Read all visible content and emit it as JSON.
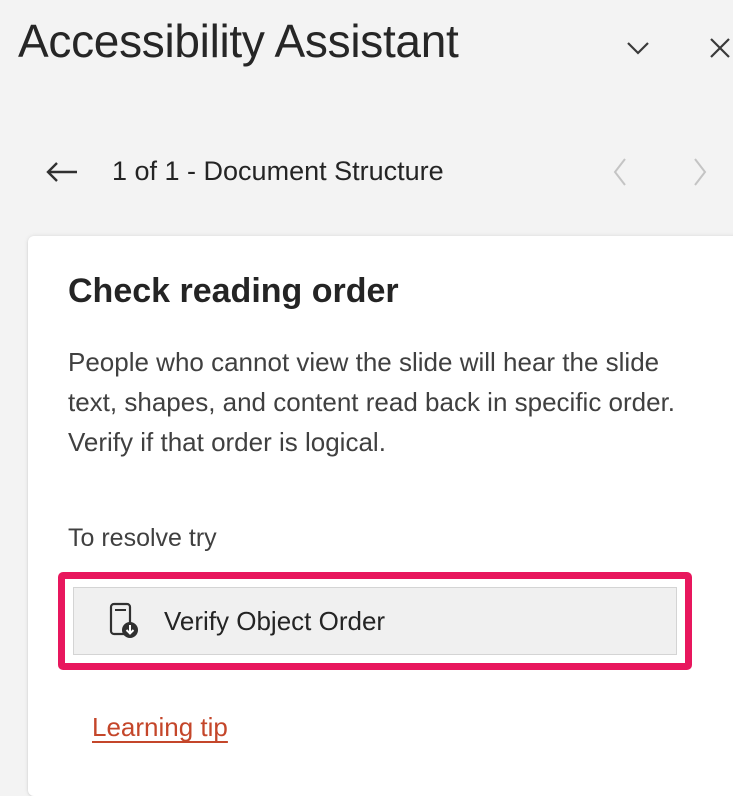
{
  "header": {
    "title": "Accessibility Assistant",
    "collapse_icon": "chevron-down-icon",
    "close_icon": "close-icon"
  },
  "navigation": {
    "back_icon": "arrow-left-icon",
    "position_text": "1 of 1 - Document Structure",
    "prev_icon": "chevron-left-icon",
    "next_icon": "chevron-right-icon"
  },
  "card": {
    "heading": "Check reading order",
    "description": "People who cannot view the slide will hear the slide text, shapes, and content read back in specific order. Verify if that order is logical.",
    "resolve_label": "To resolve try",
    "action": {
      "label": "Verify Object Order",
      "icon": "verify-object-order-icon"
    },
    "learning_tip": "Learning tip"
  },
  "colors": {
    "highlight_border": "#e8175d",
    "link": "#c4462a",
    "panel_background": "#f3f3f3",
    "card_background": "#ffffff"
  }
}
